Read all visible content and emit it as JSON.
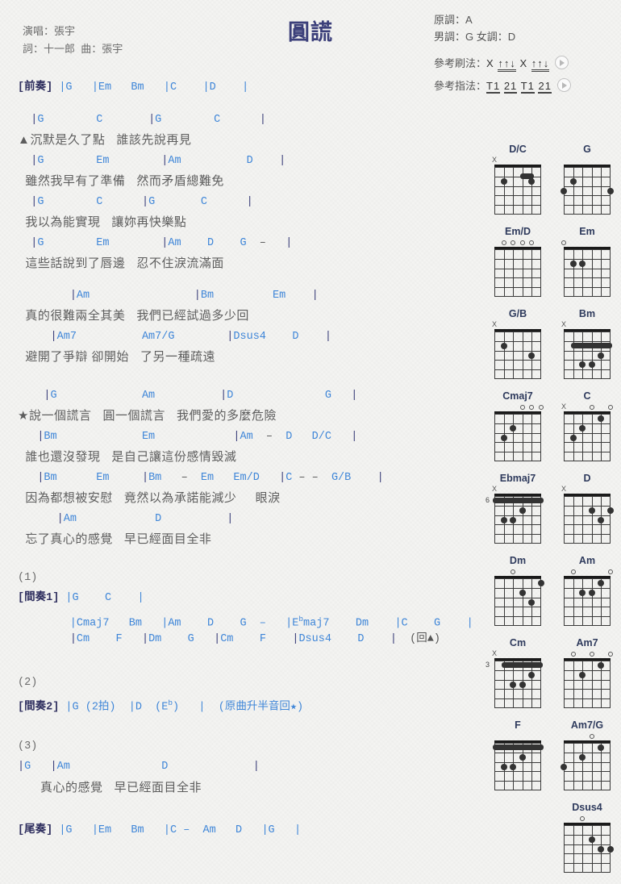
{
  "song": {
    "title": "圓謊",
    "singer_label": "演唱：張宇",
    "writer_label": "詞：十一郎  曲：張宇"
  },
  "keys": {
    "original": "原調：A",
    "male_female": "男調：G  女調：D",
    "strum_label": "參考刷法：",
    "strum_pattern_a": "X",
    "strum_pattern_b": "↑↑↓",
    "strum_pattern_c": "X",
    "strum_pattern_d": "↑↑↓",
    "finger_label": "參考指法：",
    "finger_a": "T1",
    "finger_b": "21",
    "finger_c": "T1",
    "finger_d": "21"
  },
  "sections": {
    "intro_label": "[前奏]",
    "intro_chords": "|G   |Em   Bm   |C    |D    |",
    "verse1": [
      {
        "chords": "  |G        C       |G        C      |",
        "lyric": "▲沉默是久了點   誰該先說再見"
      },
      {
        "chords": "  |G        Em        |Am          D    |",
        "lyric": "  雖然我早有了準備   然而矛盾總難免"
      },
      {
        "chords": "  |G        C      |G       C      |",
        "lyric": "  我以為能實現   讓妳再快樂點"
      },
      {
        "chords": "  |G        Em        |Am    D    G  –   |",
        "lyric": "  這些話說到了唇邊   忍不住淚流滿面"
      }
    ],
    "verse2": [
      {
        "chords": "        |Am                |Bm         Em    |",
        "lyric": "  真的很難兩全其美   我們已經試過多少回"
      },
      {
        "chords": "     |Am7          Am7/G        |Dsus4    D    |",
        "lyric": "  避開了爭辯 卻開始   了另一種疏遠"
      }
    ],
    "chorus": [
      {
        "chords": "    |G             Am          |D              G   |",
        "lyric": "★說一個謊言   圓一個謊言   我們愛的多麼危險"
      },
      {
        "chords": "   |Bm             Em            |Am  –  D   D/C   |",
        "lyric": "  誰也還沒發現   是自己讓這份感情毀滅"
      },
      {
        "chords": "   |Bm      Em     |Bm   –  Em   Em/D   |C – –  G/B    |",
        "lyric": "  因為都想被安慰   竟然以為承諾能減少     眼淚"
      },
      {
        "chords": "      |Am            D          |",
        "lyric": "  忘了真心的感覺   早已經面目全非"
      }
    ],
    "inter1_number": "(1)",
    "inter1_label": "[間奏1]",
    "inter1_line1": "|G    C    |",
    "inter1_line2_pre": "        |Cmaj7   Bm   |Am    D    G  –   |E",
    "inter1_line2_sup": "b",
    "inter1_line2_post": "maj7    Dm    |C    G    |",
    "inter1_line3": "        |Cm    F   |Dm    G   |Cm    F    |Dsus4    D    |  (回▲)",
    "inter2_number": "(2)",
    "inter2_label": "[間奏2]",
    "inter2_pre": "|G (2拍)  |D  (E",
    "inter2_sup": "b",
    "inter2_post": ")   |  (原曲升半音回★)",
    "inter3_number": "(3)",
    "inter3_line": "|G   |Am              D             |",
    "inter3_lyric": "      真心的感覺   早已經面目全非",
    "outro_label": "[尾奏]",
    "outro_chords": "|G   |Em   Bm   |C –  Am   D   |G   |"
  },
  "chord_diagrams": [
    {
      "name": "D/C",
      "top": [
        {
          "type": "x",
          "string": 6
        }
      ],
      "dots": [
        {
          "string": 5,
          "fret": 2
        },
        {
          "string": 2,
          "fret": 2
        }
      ],
      "barre": null,
      "bar2": {
        "from": 3,
        "to": 2,
        "fret": 1.45
      },
      "startfret": ""
    },
    {
      "name": "G",
      "top": [],
      "dots": [
        {
          "string": 6,
          "fret": 3
        },
        {
          "string": 5,
          "fret": 2
        },
        {
          "string": 1,
          "fret": 3
        }
      ],
      "barre": null,
      "startfret": ""
    },
    {
      "name": "Em/D",
      "top": [
        {
          "type": "o",
          "string": 5
        },
        {
          "type": "o",
          "string": 4
        },
        {
          "type": "o",
          "string": 3
        },
        {
          "type": "o",
          "string": 2
        }
      ],
      "dots": [],
      "barre": null,
      "startfret": ""
    },
    {
      "name": "Em",
      "top": [
        {
          "type": "o",
          "string": 6
        }
      ],
      "dots": [
        {
          "string": 5,
          "fret": 2
        },
        {
          "string": 4,
          "fret": 2
        }
      ],
      "barre": null,
      "startfret": ""
    },
    {
      "name": "G/B",
      "top": [
        {
          "type": "x",
          "string": 6
        }
      ],
      "dots": [
        {
          "string": 5,
          "fret": 2
        },
        {
          "string": 2,
          "fret": 3
        }
      ],
      "barre": null,
      "startfret": ""
    },
    {
      "name": "Bm",
      "top": [
        {
          "type": "x",
          "string": 6
        }
      ],
      "dots": [
        {
          "string": 2,
          "fret": 3
        },
        {
          "string": 4,
          "fret": 4
        },
        {
          "string": 3,
          "fret": 4
        }
      ],
      "barre": {
        "fret": 2,
        "from": 5,
        "to": 1
      },
      "startfret": ""
    },
    {
      "name": "Cmaj7",
      "top": [
        {
          "type": "o",
          "string": 3
        },
        {
          "type": "o",
          "string": 2
        },
        {
          "type": "o",
          "string": 1
        }
      ],
      "dots": [
        {
          "string": 5,
          "fret": 3
        },
        {
          "string": 4,
          "fret": 2
        }
      ],
      "barre": null,
      "startfret": ""
    },
    {
      "name": "C",
      "top": [
        {
          "type": "x",
          "string": 6
        },
        {
          "type": "o",
          "string": 3
        },
        {
          "type": "o",
          "string": 1
        }
      ],
      "dots": [
        {
          "string": 5,
          "fret": 3
        },
        {
          "string": 4,
          "fret": 2
        },
        {
          "string": 2,
          "fret": 1
        }
      ],
      "barre": null,
      "startfret": ""
    },
    {
      "name": "Ebmaj7",
      "top": [
        {
          "type": "x",
          "string": 6
        }
      ],
      "dots": [
        {
          "string": 3,
          "fret": 2
        },
        {
          "string": 5,
          "fret": 3
        },
        {
          "string": 4,
          "fret": 3
        }
      ],
      "barre": {
        "fret": 1,
        "from": 6,
        "to": 1
      },
      "startfret": "6"
    },
    {
      "name": "D",
      "top": [
        {
          "type": "x",
          "string": 6
        }
      ],
      "dots": [
        {
          "string": 3,
          "fret": 2
        },
        {
          "string": 1,
          "fret": 2
        },
        {
          "string": 2,
          "fret": 3
        }
      ],
      "barre": null,
      "startfret": ""
    },
    {
      "name": "Dm",
      "top": [
        {
          "type": "o",
          "string": 4
        }
      ],
      "dots": [
        {
          "string": 1,
          "fret": 1
        },
        {
          "string": 3,
          "fret": 2
        },
        {
          "string": 2,
          "fret": 3
        }
      ],
      "barre": null,
      "startfret": ""
    },
    {
      "name": "Am",
      "top": [
        {
          "type": "o",
          "string": 5
        },
        {
          "type": "o",
          "string": 1
        }
      ],
      "dots": [
        {
          "string": 2,
          "fret": 1
        },
        {
          "string": 4,
          "fret": 2
        },
        {
          "string": 3,
          "fret": 2
        }
      ],
      "barre": null,
      "startfret": ""
    },
    {
      "name": "Cm",
      "top": [
        {
          "type": "x",
          "string": 6
        }
      ],
      "dots": [
        {
          "string": 2,
          "fret": 2
        },
        {
          "string": 4,
          "fret": 3
        },
        {
          "string": 3,
          "fret": 3
        }
      ],
      "barre": {
        "fret": 1,
        "from": 5,
        "to": 1
      },
      "startfret": "3"
    },
    {
      "name": "Am7",
      "top": [
        {
          "type": "o",
          "string": 5
        },
        {
          "type": "o",
          "string": 3
        },
        {
          "type": "o",
          "string": 1
        }
      ],
      "dots": [
        {
          "string": 2,
          "fret": 1
        },
        {
          "string": 4,
          "fret": 2
        }
      ],
      "barre": null,
      "startfret": ""
    },
    {
      "name": "F",
      "top": [],
      "dots": [
        {
          "string": 3,
          "fret": 2
        },
        {
          "string": 5,
          "fret": 3
        },
        {
          "string": 4,
          "fret": 3
        }
      ],
      "barre": {
        "fret": 1,
        "from": 6,
        "to": 1
      },
      "startfret": ""
    },
    {
      "name": "Am7/G",
      "top": [
        {
          "type": "o",
          "string": 3
        }
      ],
      "dots": [
        {
          "string": 2,
          "fret": 1
        },
        {
          "string": 4,
          "fret": 2
        },
        {
          "string": 6,
          "fret": 3
        }
      ],
      "barre": null,
      "startfret": ""
    },
    {
      "name": "Dsus4",
      "top": [
        {
          "type": "o",
          "string": 4
        }
      ],
      "dots": [
        {
          "string": 3,
          "fret": 2
        },
        {
          "string": 2,
          "fret": 3
        },
        {
          "string": 1,
          "fret": 3
        }
      ],
      "barre": null,
      "startfret": ""
    }
  ],
  "colors": {
    "chord": "#3f86d8",
    "title": "#3b3f7a",
    "lyric": "#5d5d5d",
    "section": "#2e2e5e"
  }
}
